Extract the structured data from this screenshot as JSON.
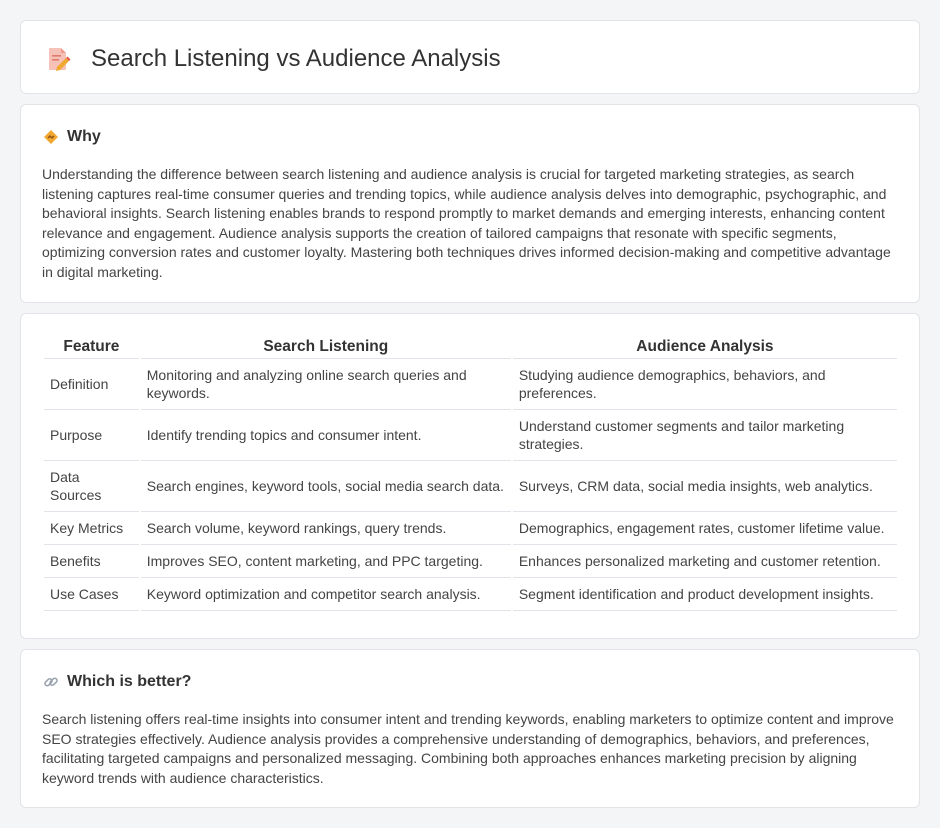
{
  "page": {
    "title": "Search Listening vs Audience Analysis",
    "title_icon": "document-pencil-icon"
  },
  "why": {
    "heading": "Why",
    "icon": "diamond-sign-icon",
    "text": "Understanding the difference between search listening and audience analysis is crucial for targeted marketing strategies, as search listening captures real-time consumer queries and trending topics, while audience analysis delves into demographic, psychographic, and behavioral insights. Search listening enables brands to respond promptly to market demands and emerging interests, enhancing content relevance and engagement. Audience analysis supports the creation of tailored campaigns that resonate with specific segments, optimizing conversion rates and customer loyalty. Mastering both techniques drives informed decision-making and competitive advantage in digital marketing."
  },
  "table": {
    "headers": [
      "Feature",
      "Search Listening",
      "Audience Analysis"
    ],
    "rows": [
      [
        "Definition",
        "Monitoring and analyzing online search queries and keywords.",
        "Studying audience demographics, behaviors, and preferences."
      ],
      [
        "Purpose",
        "Identify trending topics and consumer intent.",
        "Understand customer segments and tailor marketing strategies."
      ],
      [
        "Data Sources",
        "Search engines, keyword tools, social media search data.",
        "Surveys, CRM data, social media insights, web analytics."
      ],
      [
        "Key Metrics",
        "Search volume, keyword rankings, query trends.",
        "Demographics, engagement rates, customer lifetime value."
      ],
      [
        "Benefits",
        "Improves SEO, content marketing, and PPC targeting.",
        "Enhances personalized marketing and customer retention."
      ],
      [
        "Use Cases",
        "Keyword optimization and competitor search analysis.",
        "Segment identification and product development insights."
      ]
    ]
  },
  "better": {
    "heading": "Which is better?",
    "icon": "link-icon",
    "text": "Search listening offers real-time insights into consumer intent and trending keywords, enabling marketers to optimize content and improve SEO strategies effectively. Audience analysis provides a comprehensive understanding of demographics, behaviors, and preferences, facilitating targeted campaigns and personalized messaging. Combining both approaches enhances marketing precision by aligning keyword trends with audience characteristics."
  },
  "colors": {
    "background": "#f4f5f7",
    "card": "#ffffff",
    "border": "#e2e4e8",
    "accent_orange": "#f0a830",
    "accent_red": "#e8584a"
  }
}
